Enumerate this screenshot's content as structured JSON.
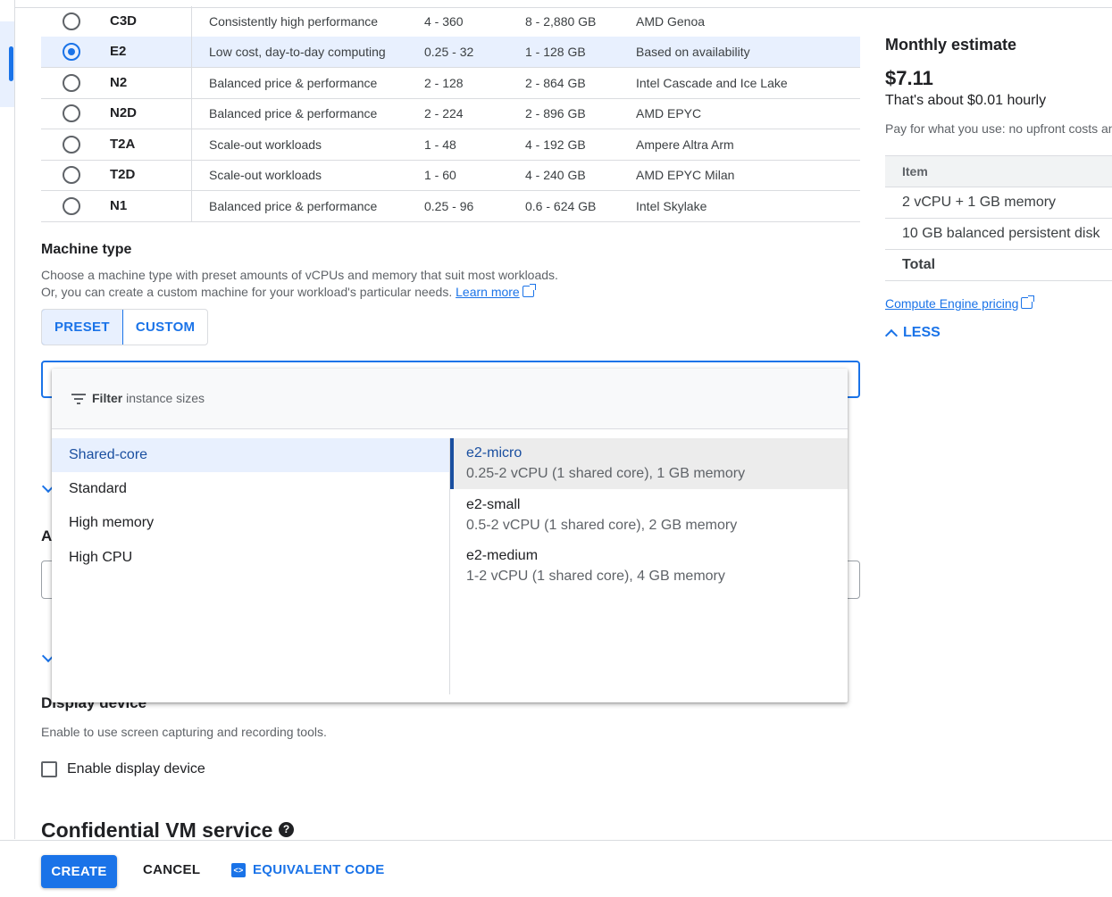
{
  "series_table": {
    "rows": [
      {
        "series": "C3D",
        "description": "Consistently high performance",
        "vcpus": "4 - 360",
        "memory": "8 - 2,880 GB",
        "platform": "AMD Genoa",
        "selected": false
      },
      {
        "series": "E2",
        "description": "Low cost, day-to-day computing",
        "vcpus": "0.25 - 32",
        "memory": "1 - 128 GB",
        "platform": "Based on availability",
        "selected": true
      },
      {
        "series": "N2",
        "description": "Balanced price & performance",
        "vcpus": "2 - 128",
        "memory": "2 - 864 GB",
        "platform": "Intel Cascade and Ice Lake",
        "selected": false
      },
      {
        "series": "N2D",
        "description": "Balanced price & performance",
        "vcpus": "2 - 224",
        "memory": "2 - 896 GB",
        "platform": "AMD EPYC",
        "selected": false
      },
      {
        "series": "T2A",
        "description": "Scale-out workloads",
        "vcpus": "1 - 48",
        "memory": "4 - 192 GB",
        "platform": "Ampere Altra Arm",
        "selected": false
      },
      {
        "series": "T2D",
        "description": "Scale-out workloads",
        "vcpus": "1 - 60",
        "memory": "4 - 240 GB",
        "platform": "AMD EPYC Milan",
        "selected": false
      },
      {
        "series": "N1",
        "description": "Balanced price & performance",
        "vcpus": "0.25 - 96",
        "memory": "0.6 - 624 GB",
        "platform": "Intel Skylake",
        "selected": false
      }
    ]
  },
  "machine_type": {
    "heading": "Machine type",
    "desc_line1": "Choose a machine type with preset amounts of vCPUs and memory that suit most workloads.",
    "desc_line2": "Or, you can create a custom machine for your workload's particular needs.",
    "learn_more": "Learn more",
    "preset_label": "PRESET",
    "custom_label": "CUSTOM",
    "obscured_heading_fragment": "A"
  },
  "dropdown": {
    "filter_label": "Filter",
    "filter_placeholder": "instance sizes",
    "families": [
      {
        "label": "Shared-core",
        "active": true
      },
      {
        "label": "Standard",
        "active": false
      },
      {
        "label": "High memory",
        "active": false
      },
      {
        "label": "High CPU",
        "active": false
      }
    ],
    "sizes": [
      {
        "name": "e2-micro",
        "description": "0.25-2 vCPU (1 shared core), 1 GB memory",
        "active": true
      },
      {
        "name": "e2-small",
        "description": "0.5-2 vCPU (1 shared core), 2 GB memory",
        "active": false
      },
      {
        "name": "e2-medium",
        "description": "1-2 vCPU (1 shared core), 4 GB memory",
        "active": false
      }
    ]
  },
  "display_device": {
    "heading": "Display device",
    "description": "Enable to use screen capturing and recording tools.",
    "checkbox_label": "Enable display device"
  },
  "confidential": {
    "heading": "Confidential VM service",
    "help_icon": "?"
  },
  "estimate": {
    "title": "Monthly estimate",
    "price": "$7.11",
    "hourly": "That's about $0.01 hourly",
    "note": "Pay for what you use: no upfront costs and per second billing",
    "table_header": "Item",
    "items": [
      "2 vCPU + 1 GB memory",
      "10 GB balanced persistent disk"
    ],
    "total_label": "Total",
    "pricing_link": "Compute Engine pricing",
    "less_label": "LESS"
  },
  "footer": {
    "create": "CREATE",
    "cancel": "CANCEL",
    "equivalent_code": "EQUIVALENT CODE",
    "code_icon": "<>"
  },
  "colors": {
    "accent": "#1a73e8",
    "selected_row": "#e8f0fe",
    "text": "#202124",
    "muted": "#5f6368",
    "divider": "#dadce0"
  }
}
